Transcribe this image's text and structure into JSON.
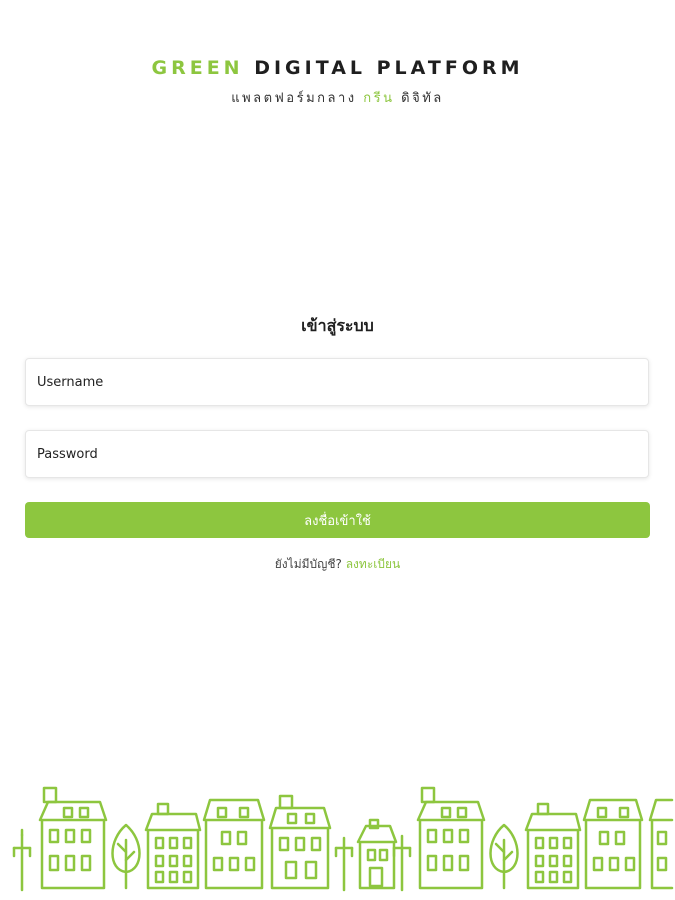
{
  "brand": {
    "title_green": "GREEN",
    "title_rest": "DIGITAL PLATFORM",
    "subtitle_prefix": "แพลตฟอร์มกลาง",
    "subtitle_green": "กรีน",
    "subtitle_suffix": "ดิจิทัล"
  },
  "login": {
    "title": "เข้าสู่ระบบ",
    "username_placeholder": "Username",
    "password_placeholder": "Password",
    "submit_label": "ลงชื่อเข้าใช้"
  },
  "register": {
    "prompt": "ยังไม่มีบัญชี?",
    "link_label": "ลงทะเบียน"
  },
  "colors": {
    "accent": "#8dc63f",
    "text": "#1f1f1f"
  },
  "icons": {
    "illustration": "town-illustration"
  }
}
